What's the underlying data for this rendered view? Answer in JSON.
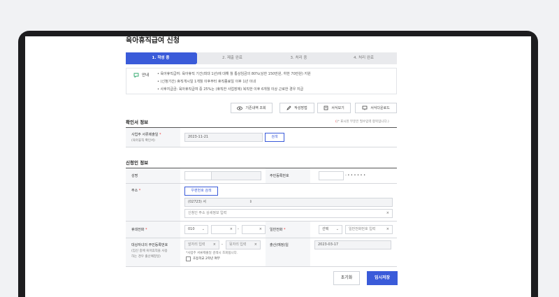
{
  "title": "육아휴직급여 신청",
  "steps": [
    {
      "label": "1. 작성 중",
      "active": true
    },
    {
      "label": "2. 제출 완료",
      "active": false
    },
    {
      "label": "3. 처리 중",
      "active": false
    },
    {
      "label": "4. 처리 완료",
      "active": false
    }
  ],
  "info": {
    "label": "안내",
    "lines": [
      "• 육아휴직급여: 육아휴직 기간(최대 1년)에 대해 월 통상임금의 80%(상한 150만원, 하한 70만원) 지원",
      "• (신청기간) 휴직개시일 1개월 이후부터 휴직종료일 이후 1년 이내",
      "• 사후지급금: 육아휴직급여 중 25%는 (휴직한 사업장에) 복직한 이후 6개월 이상 근로한 경우 지급"
    ]
  },
  "toolbar": {
    "history": "기존내역 조회",
    "guide": "작성방법",
    "form": "서식보기",
    "download": "서식다운로드"
  },
  "confirm_section": {
    "title": "확인서 정보",
    "required_note": "(* 표시된 부분은 필수입력 항목입니다.)",
    "receipt_label": "사업주 서류제출일",
    "receipt_sub": "(육아휴직 확인서)",
    "receipt_date": "2023-11-21",
    "search_btn": "검색"
  },
  "applicant_section": {
    "title": "신청인 정보",
    "name_label": "성명",
    "rrn_label": "주민등록번호",
    "rrn_masked": "- • • • • • •",
    "address_label": "주소",
    "zip_btn": "우편번호 검색",
    "address_value": "(02723) 서",
    "address_detail_placeholder": "신청인 주소 상세정보 입력",
    "mobile_label": "휴대전화",
    "mobile_prefix": "010",
    "phone_label": "일반전화",
    "phone_select": "선택",
    "phone_placeholder": "일반전화번호 입력",
    "child_label": "대상자녀의 주민등록번호",
    "child_sub1": "(임신 중에 육아휴직을 사용",
    "child_sub2": "하는 경우 출산예정일)",
    "child_front_placeholder": "앞자리 입력",
    "child_back_placeholder": "뒷자리 입력",
    "child_note": "*사업주 서류제출일 검색시 조회됩니다.",
    "checkbox_label": "초등학교 2학년 여부",
    "due_label": "출산(예정)일",
    "due_date": "2023-03-17"
  },
  "actions": {
    "reset": "초기화",
    "save": "임시저장"
  },
  "colors": {
    "accent": "#3a5bd9",
    "required": "#e33333"
  }
}
